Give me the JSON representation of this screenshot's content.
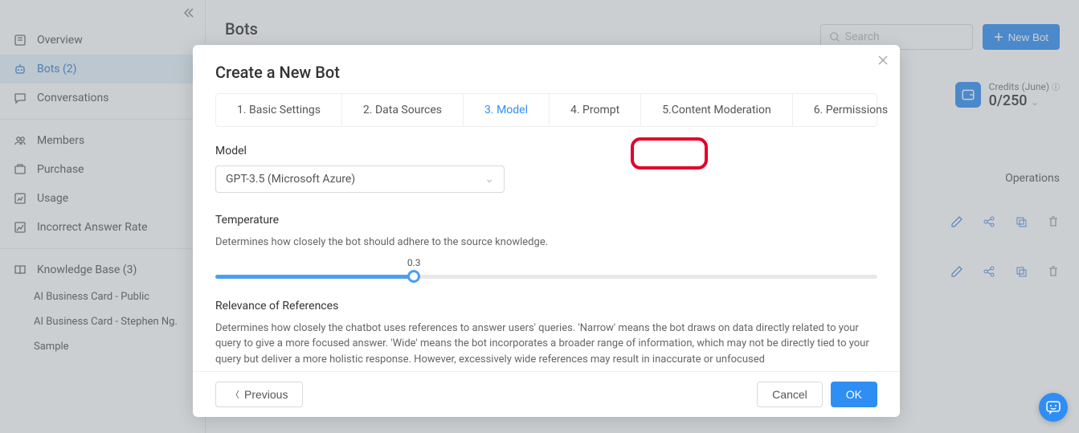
{
  "sidebar": {
    "items": [
      {
        "label": "Overview"
      },
      {
        "label": "Bots (2)"
      },
      {
        "label": "Conversations"
      },
      {
        "label": "Members"
      },
      {
        "label": "Purchase"
      },
      {
        "label": "Usage"
      },
      {
        "label": "Incorrect Answer Rate"
      }
    ],
    "kb_header": "Knowledge Base (3)",
    "kb_items": [
      "AI Business Card - Public",
      "AI Business Card - Stephen Ng.",
      "Sample"
    ]
  },
  "page": {
    "title": "Bots",
    "search_placeholder": "Search",
    "new_bot_label": "New Bot",
    "operations_header": "Operations"
  },
  "credits": {
    "label": "Credits (June)",
    "value": "0/250"
  },
  "modal": {
    "title": "Create a New Bot",
    "steps": [
      "1. Basic Settings",
      "2. Data Sources",
      "3. Model",
      "4. Prompt",
      "5.Content Moderation",
      "6. Permissions"
    ],
    "active_step_index": 2,
    "model_label": "Model",
    "model_value": "GPT-3.5 (Microsoft Azure)",
    "temp_label": "Temperature",
    "temp_help": "Determines how closely the bot should adhere to the source knowledge.",
    "temp_value": "0.3",
    "temp_percent": 30,
    "rel_label": "Relevance of References",
    "rel_help": "Determines how closely the chatbot uses references to answer users' queries. 'Narrow' means the bot draws on data directly related to your query to give a more focused answer. 'Wide' means the bot incorporates a broader range of information, which may not be directly tied to your query but deliver a more holistic response. However, excessively wide references may result in inaccurate or unfocused",
    "prev_label": "Previous",
    "cancel_label": "Cancel",
    "ok_label": "OK"
  }
}
